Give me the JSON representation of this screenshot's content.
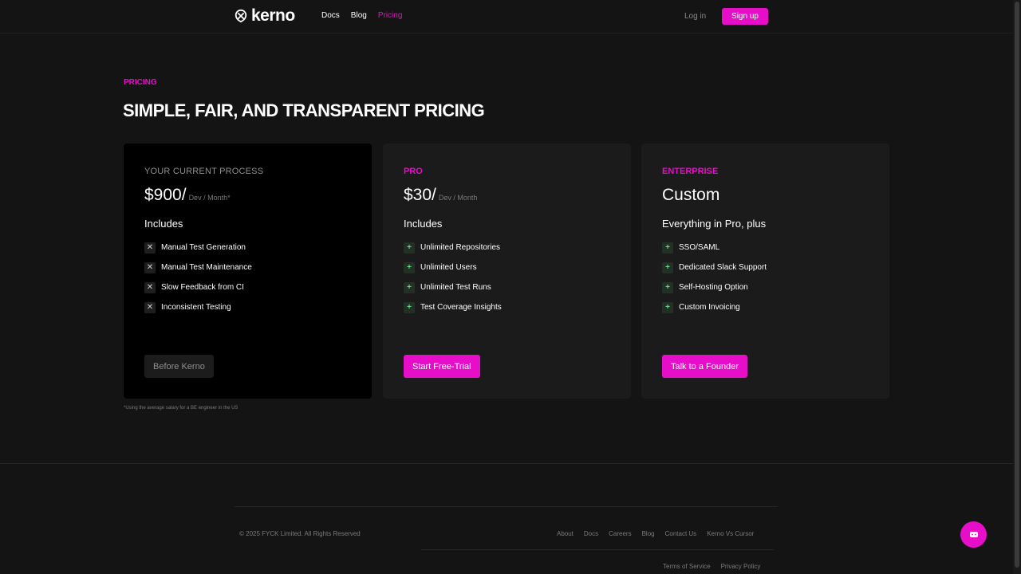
{
  "brand": {
    "name": "kerno",
    "accent": "#e60ec8"
  },
  "nav": [
    {
      "label": "Docs",
      "active": false
    },
    {
      "label": "Blog",
      "active": false
    },
    {
      "label": "Pricing",
      "active": true
    }
  ],
  "auth": {
    "login_label": "Log in",
    "signup_label": "Sign up"
  },
  "hero": {
    "eyebrow": "PRICING",
    "title": "SIMPLE, FAIR, AND TRANSPARENT PRICING"
  },
  "plans": [
    {
      "name": "YOUR CURRENT PROCESS",
      "price": "$900/",
      "unit": "Dev / Month*",
      "includes_label": "Includes",
      "features": [
        "Manual Test Generation",
        "Manual Test Maintenance",
        "Slow Feedback from CI",
        "Inconsistent Testing"
      ],
      "cta": "Before Kerno"
    },
    {
      "name": "PRO",
      "price": "$30/",
      "unit": "Dev / Month",
      "includes_label": "Includes",
      "features": [
        "Unlimited Repositories",
        "Unlimited Users",
        "Unlimited Test Runs",
        "Test Coverage Insights"
      ],
      "cta": "Start Free-Trial"
    },
    {
      "name": "ENTERPRISE",
      "price": "Custom",
      "includes_label": "Everything in Pro, plus",
      "features": [
        "SSO/SAML",
        "Dedicated Slack Support",
        "Self-Hosting Option",
        "Custom Invoicing"
      ],
      "cta": "Talk to a Founder"
    }
  ],
  "footnote": "*Using the average salary for a BE engineer in the US",
  "footer": {
    "copyright": "© 2025 FYCK Limited. All Rights Reserved",
    "links": [
      "About",
      "Docs",
      "Careers",
      "Blog",
      "Contact Us",
      "Kerno Vs Cursor"
    ],
    "legal": [
      "Terms of Service",
      "Privacy Policy"
    ]
  },
  "icons": {
    "logo": "kerno-logo-icon",
    "cross": "cross-icon",
    "plus": "plus-icon",
    "chat": "chat-icon"
  }
}
